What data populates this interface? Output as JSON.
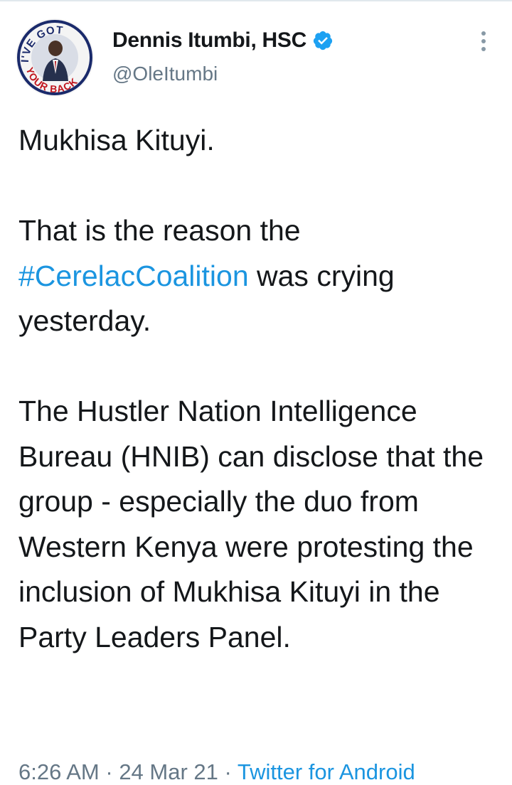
{
  "author": {
    "display_name": "Dennis Itumbi, HSC",
    "handle": "@OleItumbi",
    "verified": true,
    "avatar_badge_text": "I'VE GOT YOUR BACK"
  },
  "tweet": {
    "para1": "Mukhisa Kituyi.",
    "para2_before": "That is the reason the ",
    "para2_hashtag": "#CerelacCoalition",
    "para2_after": " was crying yesterday.",
    "para3": "The Hustler Nation Intelligence Bureau (HNIB) can disclose that the group - especially the duo from Western Kenya were protesting the inclusion of Mukhisa Kituyi in the Party Leaders Panel."
  },
  "meta": {
    "time": "6:26 AM",
    "separator": " · ",
    "date": "24 Mar 21",
    "source": "Twitter for Android"
  },
  "colors": {
    "link": "#1b95e0",
    "secondary_text": "#657786",
    "verified_badge": "#1da1f2"
  },
  "icons": {
    "verified": "verified-badge-icon",
    "more": "more-options-icon"
  }
}
